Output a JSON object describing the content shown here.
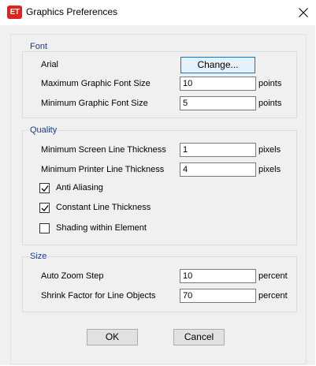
{
  "window": {
    "title": "Graphics Preferences",
    "app_icon_text": "ET",
    "close_icon": "close-icon"
  },
  "font_group": {
    "title": "Font",
    "current_font": "Arial",
    "change_button": "Change...",
    "max_size": {
      "label": "Maximum Graphic Font Size",
      "value": "10",
      "unit": "points"
    },
    "min_size": {
      "label": "Minimum Graphic Font Size",
      "value": "5",
      "unit": "points"
    }
  },
  "quality_group": {
    "title": "Quality",
    "screen_line": {
      "label": "Minimum Screen Line Thickness",
      "value": "1",
      "unit": "pixels"
    },
    "printer_line": {
      "label": "Minimum Printer Line Thickness",
      "value": "4",
      "unit": "pixels"
    },
    "anti_aliasing": {
      "label": "Anti Aliasing",
      "checked": true
    },
    "constant_line": {
      "label": "Constant Line Thickness",
      "checked": true
    },
    "shading": {
      "label": "Shading within Element",
      "checked": false
    }
  },
  "size_group": {
    "title": "Size",
    "zoom_step": {
      "label": "Auto Zoom Step",
      "value": "10",
      "unit": "percent"
    },
    "shrink_factor": {
      "label": "Shrink Factor for Line Objects",
      "value": "70",
      "unit": "percent"
    }
  },
  "buttons": {
    "ok": "OK",
    "cancel": "Cancel"
  },
  "colors": {
    "group_title": "#1a3a8c",
    "app_icon": "#e2231a",
    "accent": "#0078d7"
  }
}
